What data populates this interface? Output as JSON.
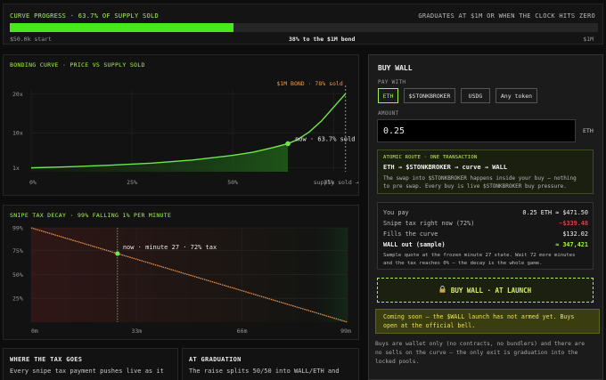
{
  "progress": {
    "title": "CURVE PROGRESS · 63.7% OF SUPPLY SOLD",
    "graduation_note": "GRADUATES AT $1M OR WHEN THE CLOCK HITS ZERO",
    "fraction": 0.38,
    "start_label": "$50.0k start",
    "center_label": "38% to the $1M bond",
    "end_label": "$1M",
    "bar_color": "#49e81e"
  },
  "chart_data": [
    {
      "type": "area",
      "title": "BONDING CURVE · PRICE VS SUPPLY SOLD",
      "x_ticks": [
        "0%",
        "25%",
        "50%",
        "supply sold →"
      ],
      "x_tick_values": [
        0,
        25,
        50,
        75
      ],
      "x_overlap_tick": "75%",
      "y_ticks": [
        "1x",
        "10x",
        "20x"
      ],
      "y_tick_values": [
        1,
        10,
        20
      ],
      "xlim": [
        0,
        78.5
      ],
      "ylim": [
        0,
        21
      ],
      "series": [
        {
          "x": [
            0,
            10,
            20,
            30,
            40,
            50,
            55,
            60,
            63.7,
            66,
            69,
            72,
            75,
            78
          ],
          "y": [
            1.0,
            1.3,
            1.7,
            2.2,
            3.0,
            4.2,
            5.0,
            6.2,
            7.2,
            8.2,
            10.2,
            13.0,
            16.5,
            20.0
          ]
        }
      ],
      "current_x": 63.7,
      "current_y": 7.2,
      "current_label": "now · 63.7% sold · 7",
      "bond_x": 78,
      "bond_label": "$1M BOND · 78% sold",
      "line_color": "#6fe84a",
      "bond_color": "#e89a4a"
    },
    {
      "type": "line",
      "title": "SNIPE TAX DECAY · 99% FALLING 1% PER MINUTE",
      "x_ticks": [
        "0m",
        "33m",
        "66m",
        "99m"
      ],
      "x_tick_values": [
        0,
        33,
        66,
        99
      ],
      "y_ticks": [
        "25%",
        "50%",
        "75%",
        "99%"
      ],
      "y_tick_values": [
        25,
        50,
        75,
        99
      ],
      "xlim": [
        0,
        99
      ],
      "ylim": [
        0,
        99
      ],
      "series": [
        {
          "x": [
            0,
            99
          ],
          "y": [
            99,
            0
          ]
        }
      ],
      "current_x": 27,
      "current_y": 72,
      "current_label": "now · minute 27 · 72% tax",
      "line_color": "#e8904a"
    }
  ],
  "tax_goes": {
    "title": "WHERE THE TAX GOES",
    "body": "Every snipe tax payment pushes live as it"
  },
  "at_graduation": {
    "title": "AT GRADUATION",
    "body": "The raise splits 50/50 into WALL/ETH and"
  },
  "buy_wall": {
    "title": "BUY WALL",
    "pay_with_label": "PAY WITH",
    "pay_options": [
      "ETH",
      "$STONKBROKER",
      "USDG",
      "Any token"
    ],
    "selected_option": "ETH",
    "amount_label": "AMOUNT",
    "amount_value": "0.25",
    "amount_unit": "ETH",
    "route_title": "ATOMIC ROUTE · ONE TRANSACTION",
    "route_flow": "ETH → $STONKBROKER → curve → WALL",
    "route_desc_line1": "The swap into $STONKBROKER happens inside your buy — nothing",
    "route_desc_line2": "to pre swap. Every buy is live $STONKBROKER buy pressure.",
    "quote": [
      {
        "label": "You pay",
        "value": "0.25 ETH ≈ $471.50",
        "color": "#f0f0f0"
      },
      {
        "label": "Snipe tax right now (72%)",
        "value": "−$339.48",
        "color": "#ff5a5a"
      },
      {
        "label": "Fills the curve",
        "value": "$132.02",
        "color": "#f0f0f0"
      },
      {
        "label": "WALL out (sample)",
        "value": "≈ 347,421",
        "color": "#a6f04a"
      }
    ],
    "quote_note_line1": "Sample quote at the frozen minute 27 state. Wait 72 more minutes",
    "quote_note_line2": "and the tax reaches 0% — the decay is the whole game.",
    "buy_button": "BUY WALL · AT LAUNCH",
    "lock_icon": "lock-icon",
    "coming_soon_line1": "Coming soon — the $WALL launch has not armed yet. Buys",
    "coming_soon_line2": "open at the official bell.",
    "footer_line1": "Buys are wallet only (no contracts, no bundlers) and there are",
    "footer_line2": "no sells on the curve — the only exit is graduation into the",
    "footer_line3": "locked pools."
  }
}
